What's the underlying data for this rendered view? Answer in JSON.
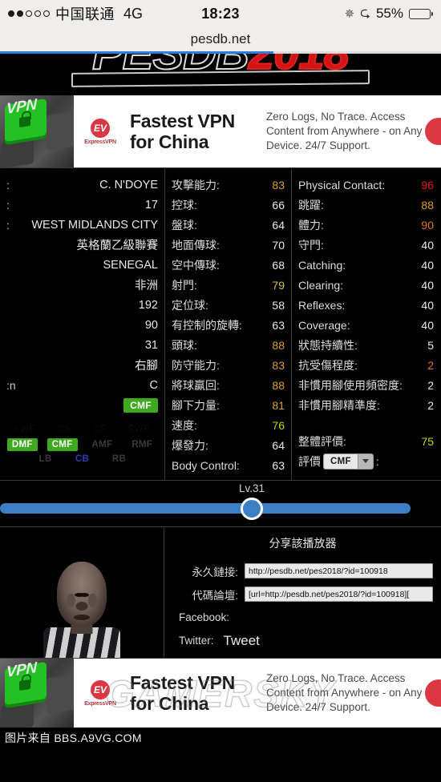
{
  "statusbar": {
    "signal_dots": [
      true,
      true,
      false,
      false,
      false
    ],
    "carrier": "中国联通",
    "network": "4G",
    "time": "18:23",
    "battery_percent": "55%",
    "battery_level": 55,
    "icons": {
      "spinner": "spinner-icon",
      "bluetooth": "bluetooth-icon",
      "battery": "battery-icon"
    }
  },
  "browser": {
    "url": "pesdb.net",
    "progress": 62
  },
  "site": {
    "logo_main": "PESDB",
    "logo_year": "2018"
  },
  "ad": {
    "headline_line1": "Fastest VPN",
    "headline_line2": "for China",
    "body": "Zero Logs, No Trace. Access Content from Anywhere - on Any Device. 24/7 Support.",
    "brand_mark": "EV",
    "brand_name": "ExpressVPN",
    "key_label": "VPN"
  },
  "player_info": [
    {
      "label": ":",
      "value": "C. N'DOYE"
    },
    {
      "label": ":",
      "value": "17"
    },
    {
      "label": ":",
      "value": "WEST MIDLANDS CITY"
    },
    {
      "label": "",
      "value": "英格蘭乙級聯賽"
    },
    {
      "label": "",
      "value": "SENEGAL"
    },
    {
      "label": "",
      "value": "非洲"
    },
    {
      "label": "",
      "value": "192"
    },
    {
      "label": "",
      "value": "90"
    },
    {
      "label": "",
      "value": "31"
    },
    {
      "label": "",
      "value": "右腳"
    },
    {
      "label": "n:",
      "value": "C"
    }
  ],
  "player_position_badge": "CMF",
  "position_map": {
    "row_dim": [
      "LWF",
      "SS",
      "CF",
      "RWF"
    ],
    "row_mid": [
      "DMF",
      "CMF",
      "AMF",
      "RMF"
    ],
    "row_mid_on": [
      "DMF",
      "CMF"
    ],
    "row_bottom": [
      "LB",
      "CB",
      "RB"
    ],
    "row_bottom_highlight": "CB"
  },
  "attributes_left": [
    {
      "label": "攻擊能力:",
      "value": "83",
      "color": "gold"
    },
    {
      "label": "控球:",
      "value": "66",
      "color": "white"
    },
    {
      "label": "盤球:",
      "value": "64",
      "color": "white"
    },
    {
      "label": "地面傳球:",
      "value": "70",
      "color": "white"
    },
    {
      "label": "空中傳球:",
      "value": "68",
      "color": "white"
    },
    {
      "label": "射門:",
      "value": "79",
      "color": "yellow"
    },
    {
      "label": "定位球:",
      "value": "58",
      "color": "white"
    },
    {
      "label": "有控制的旋轉:",
      "value": "63",
      "color": "white"
    },
    {
      "label": "頭球:",
      "value": "88",
      "color": "gold"
    },
    {
      "label": "防守能力:",
      "value": "83",
      "color": "gold"
    },
    {
      "label": "將球贏回:",
      "value": "88",
      "color": "gold"
    },
    {
      "label": "腳下力量:",
      "value": "81",
      "color": "gold"
    },
    {
      "label": "速度:",
      "value": "76",
      "color": "green"
    },
    {
      "label": "爆發力:",
      "value": "64",
      "color": "white"
    },
    {
      "label": "Body Control:",
      "value": "63",
      "color": "white"
    }
  ],
  "attributes_right": [
    {
      "label": "Physical Contact:",
      "value": "96",
      "color": "red"
    },
    {
      "label": "跳躍:",
      "value": "88",
      "color": "gold"
    },
    {
      "label": "體力:",
      "value": "90",
      "color": "orange"
    },
    {
      "label": "守門:",
      "value": "40",
      "color": "white"
    },
    {
      "label": "Catching:",
      "value": "40",
      "color": "white"
    },
    {
      "label": "Clearing:",
      "value": "40",
      "color": "white"
    },
    {
      "label": "Reflexes:",
      "value": "40",
      "color": "white"
    },
    {
      "label": "Coverage:",
      "value": "40",
      "color": "white"
    },
    {
      "label": "狀態持續性:",
      "value": "5",
      "color": "white"
    },
    {
      "label": "抗受傷程度:",
      "value": "2",
      "color": "orange"
    },
    {
      "label": "非慣用腳使用頻密度:",
      "value": "2",
      "color": "white"
    },
    {
      "label": "非慣用腳精準度:",
      "value": "2",
      "color": "white"
    }
  ],
  "overall": {
    "label": "整體評價:",
    "value": "75"
  },
  "eval_select": {
    "label_prefix": "評價",
    "selected": "CMF",
    "label_suffix": ":"
  },
  "level_slider": {
    "label": "Lv.31",
    "value": 31,
    "percent": 57
  },
  "share": {
    "title": "分享該播放器",
    "permalink_label": "永久鏈接:",
    "permalink_value": "http://pesdb.net/pes2018/?id=100918",
    "bbcode_label": "代碼論壇:",
    "bbcode_value": "[url=http://pesdb.net/pes2018/?id=100918][",
    "facebook_label": "Facebook:",
    "twitter_label": "Twitter:",
    "tweet_button": "Tweet"
  },
  "footer": {
    "watermark": "GAMERSKY",
    "credit": "图片来自 BBS.A9VG.COM"
  }
}
